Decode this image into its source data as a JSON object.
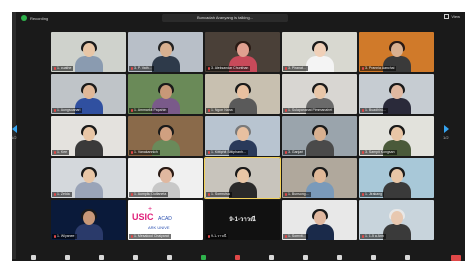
{
  "window": {
    "recording_label": "Recording",
    "speaker_label": "Buncadah Aranyang is talking...",
    "view_label": "View",
    "page_left": "1/2",
    "page_right": "1/2"
  },
  "colors": {
    "accent": "#35a3f0",
    "recording": "#2fb24c",
    "muted": "#e04848",
    "active_outline": "#f2d15a"
  },
  "tiles": [
    {
      "name": "1. cuathe",
      "bg": "#cfd2cc",
      "skin": "#e8c6a6",
      "hair": "#1a1a1a",
      "shirt": "#8a9bb0",
      "active": false
    },
    {
      "name": "3. P. Vath...",
      "bg": "#b8bfc8",
      "skin": "#d8b090",
      "hair": "#222222",
      "shirt": "#2e3a4a",
      "active": false
    },
    {
      "name": "3. Aleksandar Chunthan",
      "bg": "#4a4038",
      "skin": "#e0a090",
      "hair": "#2a1a14",
      "shirt": "#c84a5a",
      "active": false
    },
    {
      "name": "3. Piranat...",
      "bg": "#d8d8d0",
      "skin": "#f0d0b8",
      "hair": "#1a1a1a",
      "shirt": "#f4f4f4",
      "active": false
    },
    {
      "name": "3. Prannia Aanchai",
      "bg": "#d07a2a",
      "skin": "#d8b090",
      "hair": "#2a1a14",
      "shirt": "#3a3a3a",
      "active": false
    },
    {
      "name": "1. Aungsoanari",
      "bg": "#bfc4c8",
      "skin": "#e0b898",
      "hair": "#1a1a1a",
      "shirt": "#3050a0",
      "active": false
    },
    {
      "name": "1. Ammarkit Papahin",
      "bg": "#6a8a58",
      "skin": "#c89878",
      "hair": "#1a1a1a",
      "shirt": "#7a5a8a",
      "active": false
    },
    {
      "name": "1. Ngon Nana",
      "bg": "#c8c0b0",
      "skin": "#e8c0a0",
      "hair": "#1a1a1a",
      "shirt": "#5a5a5a",
      "active": false
    },
    {
      "name": "1. Sulapananat Pimmanahet",
      "bg": "#d8d6d2",
      "skin": "#e8c6a8",
      "hair": "#1a1a1a",
      "shirt": "#6a6a6a",
      "active": false
    },
    {
      "name": "1. Buadhiru...",
      "bg": "#c6ccd2",
      "skin": "#e0b8a0",
      "hair": "#1a1a1a",
      "shirt": "#2a2a3a",
      "active": false
    },
    {
      "name": "1. Kee",
      "bg": "#e4e2de",
      "skin": "#e8c6a6",
      "hair": "#1a1a1a",
      "shirt": "#3a3a3a",
      "active": false
    },
    {
      "name": "1. Vanakannich",
      "bg": "#8a6a4a",
      "skin": "#d0a080",
      "hair": "#1a1a1a",
      "shirt": "#6a8a5a",
      "active": false
    },
    {
      "name": "1. Kittiphit Sittiphanh...",
      "bg": "#b8c4d0",
      "skin": "#e8c0a0",
      "hair": "#7a7a7a",
      "shirt": "#2a3a5a",
      "active": false
    },
    {
      "name": "3. Ganjari",
      "bg": "#9aa4ac",
      "skin": "#d8b090",
      "hair": "#1a1a1a",
      "shirt": "#4a4a4a",
      "active": false
    },
    {
      "name": "3. Sampit Kongsan",
      "bg": "#e2e2dc",
      "skin": "#e8c6a6",
      "hair": "#1a1a1a",
      "shirt": "#4a5a3a",
      "active": false
    },
    {
      "name": "1. Zelda",
      "bg": "#d4d8dc",
      "skin": "#e8c6a6",
      "hair": "#1a1a1a",
      "shirt": "#9aa4b8",
      "active": false
    },
    {
      "name": "1. Aumpliu Dulfaneta",
      "bg": "#f0f0f0",
      "skin": "#e0b8a0",
      "hair": "#2a1a14",
      "shirt": "#c8c8c8",
      "active": false
    },
    {
      "name": "1. Somrutsa",
      "bg": "#c8c4bc",
      "skin": "#e8c6a6",
      "hair": "#1a1a1a",
      "shirt": "#2a2a2a",
      "active": true
    },
    {
      "name": "1. Bunsong...",
      "bg": "#b0a89c",
      "skin": "#e0b898",
      "hair": "#1a1a1a",
      "shirt": "#7a9aba",
      "active": false
    },
    {
      "name": "1. Jirakang",
      "bg": "#a8c8d8",
      "skin": "#e8c6a6",
      "hair": "#1a1a1a",
      "shirt": "#3a3a3a",
      "active": false
    },
    {
      "name": "1. Wiyanee",
      "bg": "#0a1a3a",
      "skin": "#c89878",
      "hair": "#1a1a1a",
      "shirt": "#2a3a6a",
      "active": false
    },
    {
      "name": "1. Mesakool Chaiyarat",
      "bg": "#ffffff",
      "logo_main": "USIC",
      "logo_sub": "ACAD",
      "logo_bottom": "ARK UNIVE",
      "active": false
    },
    {
      "name": "9-1-วาวณี",
      "bg": "#111111",
      "display_text": "9-1-วาวณี",
      "active": false
    },
    {
      "name": "1. Somvit...",
      "bg": "#e8e8e8",
      "skin": "#e0b8a0",
      "hair": "#1a1a1a",
      "shirt": "#1a2a4a",
      "active": false
    },
    {
      "name": "1. 1-5 a Ann",
      "bg": "#c8d4dc",
      "skin": "#e8c8b0",
      "hair": "#e8e8e8",
      "shirt": "#3a3a3a",
      "active": false
    }
  ],
  "toolbar": {
    "items": [
      "mute",
      "video",
      "security",
      "participants",
      "chat",
      "share",
      "record",
      "reactions",
      "apps",
      "more",
      "view",
      "more2"
    ]
  }
}
